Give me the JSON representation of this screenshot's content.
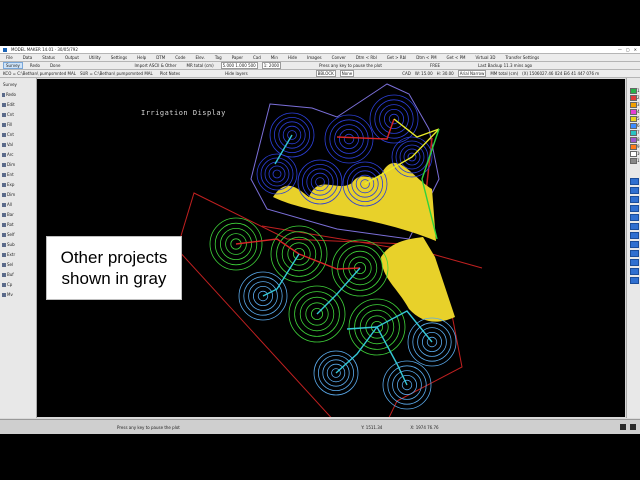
{
  "app": {
    "title": "MODEL MAKER 14.01 · 30/05/792"
  },
  "menu": [
    "File",
    "Data",
    "Status",
    "Output",
    "Utility",
    "Settings",
    "Help",
    "DTM",
    "Code",
    "Elev.",
    "Tag",
    "Paper",
    "Cad",
    "Min",
    "Hide",
    "Images",
    "Conver",
    "Dtm < Rbl",
    "Get > Rbl",
    "Dtm < PM",
    "Get < PM",
    "Virtual 3D",
    "Transfer Settings"
  ],
  "toolbar1": {
    "items": [
      "Survey",
      "Redo",
      "Done",
      "Import ASCII & Other",
      "MR total (cm)"
    ],
    "coord_value": "5.000 1.000 500",
    "scale_value": "1: 2000",
    "prompt": "Press any key to pause the plot",
    "free_label": "FREE",
    "backup": "Last Backup 11.3 mins ago"
  },
  "toolbar2": {
    "file1": "KCO = C:\\Bethan\\ pumpsmnted MAL",
    "file2": "SUR = C:\\Bethan\\ pumpsmnted MAL",
    "plot_notes": "Plot Notes",
    "hide_layers": "Hide layers",
    "layer": "BBLOCK",
    "style": "None",
    "cad_label": "CAD",
    "w_label": "W: 15.00",
    "h_label": "H: 30.00",
    "font": "Arial Narrow",
    "mm_total": "MM total (cm)",
    "coords": "(X) 1506027.46 024 Ei6 41 447 076 m"
  },
  "left_tools": [
    "Survey",
    "Redo",
    "Edit",
    "Cnt",
    "Fill",
    "Cnt",
    "Val",
    "Arc",
    "Dim",
    "Ent",
    "Exp",
    "Dim",
    "All",
    "Bar",
    "Rot",
    "Self",
    "Sub",
    "Extr",
    "Sel",
    "Buf",
    "Cp",
    "Mv"
  ],
  "right_layers": {
    "numbers": [
      "1",
      "2",
      "3",
      "4",
      "5",
      "6",
      "7",
      "8",
      "9",
      "10",
      "11"
    ],
    "colors": [
      "#27b34a",
      "#e03a3a",
      "#f0a000",
      "#e53ed6",
      "#e8d21f",
      "#3c8cff",
      "#29c4c4",
      "#9b59d0",
      "#ff7a1a",
      "#ffffff",
      "#888888"
    ]
  },
  "canvas": {
    "label": "Irrigation Display",
    "colors": {
      "background": "#000000",
      "zone_outline_upper": "#7b6fd8",
      "zone_outline_lower": "#c02020",
      "fill_yellow": "#e8d12a",
      "pipe_cyan": "#35c8d6",
      "pipe_red": "#d82626",
      "pipe_yellow": "#eaea2a",
      "pipe_green": "#2fd23c",
      "ring_blue": "#2c3fd6",
      "ring_green": "#3fd23a",
      "ring_lightblue": "#5aa9ea"
    }
  },
  "callout": {
    "text": "Other projects shown in gray"
  },
  "statusbar": {
    "message": "Press any key to pause the plot",
    "coord_y": "Y: 1511.34",
    "coord_x": "X: 1974 76.76"
  }
}
